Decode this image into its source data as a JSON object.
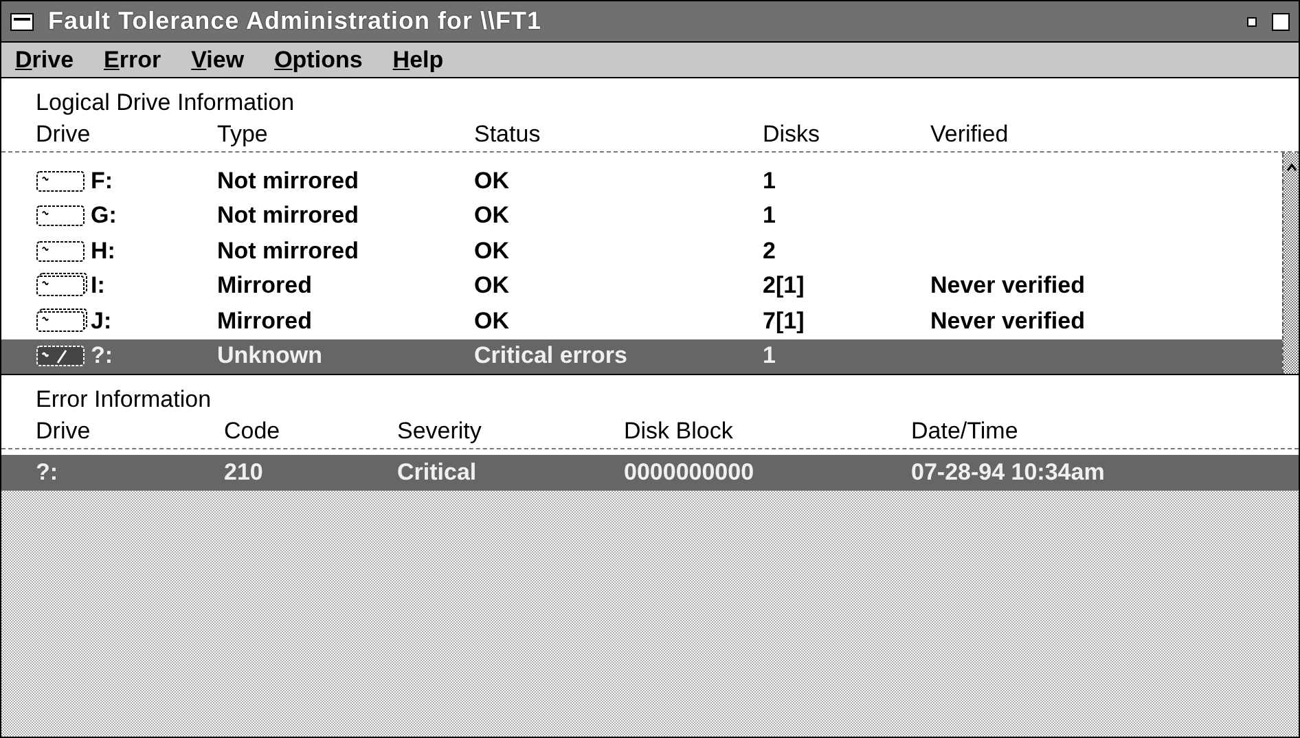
{
  "window": {
    "title": "Fault Tolerance Administration for \\\\FT1"
  },
  "menu": [
    "Drive",
    "Error",
    "View",
    "Options",
    "Help"
  ],
  "logical_drives": {
    "title": "Logical Drive Information",
    "columns": [
      "Drive",
      "Type",
      "Status",
      "Disks",
      "Verified"
    ],
    "rows": [
      {
        "kind": "single",
        "drive": "F:",
        "type": "Not mirrored",
        "status": "OK",
        "disks": "1",
        "verified": "",
        "selected": false
      },
      {
        "kind": "single",
        "drive": "G:",
        "type": "Not mirrored",
        "status": "OK",
        "disks": "1",
        "verified": "",
        "selected": false
      },
      {
        "kind": "single",
        "drive": "H:",
        "type": "Not mirrored",
        "status": "OK",
        "disks": "2",
        "verified": "",
        "selected": false
      },
      {
        "kind": "mirrored",
        "drive": "I:",
        "type": "Mirrored",
        "status": "OK",
        "disks": "2[1]",
        "verified": "Never verified",
        "selected": false
      },
      {
        "kind": "mirrored",
        "drive": "J:",
        "type": "Mirrored",
        "status": "OK",
        "disks": "7[1]",
        "verified": "Never verified",
        "selected": false
      },
      {
        "kind": "broken",
        "drive": "?:",
        "type": "Unknown",
        "status": "Critical errors",
        "disks": "1",
        "verified": "",
        "selected": true
      }
    ]
  },
  "errors": {
    "title": "Error Information",
    "columns": [
      "Drive",
      "Code",
      "Severity",
      "Disk Block",
      "Date/Time"
    ],
    "rows": [
      {
        "drive": "?:",
        "code": "210",
        "severity": "Critical",
        "block": "0000000000",
        "time": "07-28-94 10:34am",
        "selected": true
      }
    ]
  }
}
